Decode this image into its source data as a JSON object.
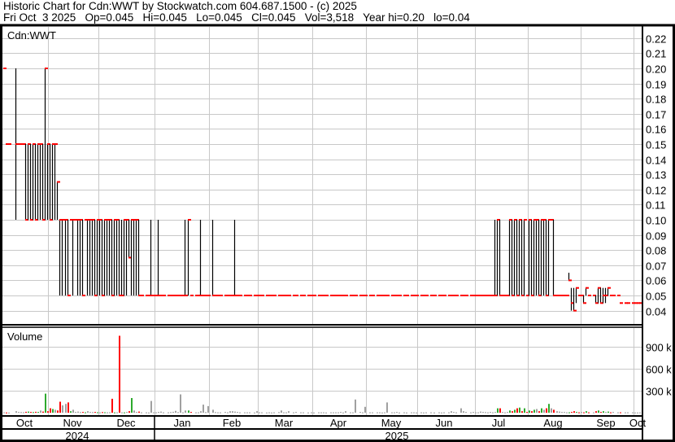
{
  "header": {
    "title": "Historic Chart for Cdn:WWT by Stockwatch.com 604.687.1500 - (c) 2025",
    "quote": "Fri Oct  3 2025   Op=0.045   Hi=0.045   Lo=0.045   Cl=0.045   Vol=3,518   Year hi=0.20   lo=0.04"
  },
  "chart_data": {
    "type": "bar",
    "subtype": "ohlc-with-volume",
    "symbol_label": "Cdn:WWT",
    "volume_label": "Volume",
    "price_axis": {
      "ticks": [
        0.04,
        0.05,
        0.06,
        0.07,
        0.08,
        0.09,
        0.1,
        0.11,
        0.12,
        0.13,
        0.14,
        0.15,
        0.16,
        0.17,
        0.18,
        0.19,
        0.2,
        0.21,
        0.22
      ],
      "range": [
        0.03,
        0.229
      ]
    },
    "volume_axis": {
      "ticks": [
        300,
        600,
        900
      ],
      "tick_labels": [
        "300 k",
        "600 k",
        "900 k"
      ],
      "unit": "k",
      "range": [
        0,
        1200
      ]
    },
    "months": [
      "Oct",
      "Nov",
      "Dec",
      "Jan",
      "Feb",
      "Mar",
      "Apr",
      "May",
      "Jun",
      "Jul",
      "Aug",
      "Sep",
      "Oct"
    ],
    "years": [
      "2024",
      "2025"
    ],
    "colors": {
      "close_tick": "#ff0000",
      "bar": "#000000",
      "vol_up": "#2eaa2e",
      "vol_down": "#ff0000",
      "vol_flat": "#a0a0a0",
      "grid": "#c8c8c8"
    },
    "bars_format": [
      "high",
      "low",
      "close",
      "volume_k"
    ],
    "bars": [
      [
        0.2,
        0.2,
        0.2,
        5
      ],
      [
        0.15,
        0.15,
        0.15,
        3
      ],
      [
        0.15,
        0.15,
        0.15,
        2
      ],
      null,
      null,
      [
        0.2,
        0.1,
        0.15,
        20
      ],
      [
        0.15,
        0.15,
        0.15,
        10
      ],
      [
        0.15,
        0.15,
        0.15,
        8
      ],
      [
        0.15,
        0.15,
        0.15,
        6
      ],
      [
        0.15,
        0.1,
        0.1,
        12
      ],
      [
        0.15,
        0.1,
        0.15,
        15
      ],
      [
        0.15,
        0.1,
        0.1,
        10
      ],
      [
        0.15,
        0.1,
        0.15,
        8
      ],
      [
        0.15,
        0.1,
        0.1,
        12
      ],
      [
        0.15,
        0.1,
        0.15,
        10
      ],
      [
        0.15,
        0.1,
        0.15,
        30
      ],
      [
        0.15,
        0.1,
        0.1,
        15
      ],
      [
        0.2,
        0.1,
        0.2,
        260
      ],
      [
        0.15,
        0.1,
        0.15,
        20
      ],
      [
        0.15,
        0.1,
        0.1,
        60
      ],
      [
        0.15,
        0.1,
        0.15,
        50
      ],
      [
        0.15,
        0.1,
        0.15,
        40
      ],
      [
        0.125,
        0.1,
        0.125,
        30
      ],
      [
        0.1,
        0.05,
        0.1,
        150
      ],
      [
        0.1,
        0.05,
        0.1,
        100
      ],
      [
        0.1,
        0.05,
        0.1,
        120
      ],
      [
        0.1,
        0.05,
        0.05,
        140
      ],
      [
        0.1,
        0.1,
        0.1,
        20
      ],
      [
        0.1,
        0.05,
        0.1,
        40
      ],
      [
        0.1,
        0.1,
        0.1,
        10
      ],
      [
        0.1,
        0.05,
        0.1,
        15
      ],
      [
        0.1,
        0.05,
        0.1,
        8
      ],
      [
        0.1,
        0.05,
        0.05,
        10
      ],
      [
        0.1,
        0.1,
        0.1,
        5
      ],
      [
        0.1,
        0.05,
        0.1,
        20
      ],
      [
        0.1,
        0.05,
        0.1,
        10
      ],
      [
        0.1,
        0.05,
        0.1,
        8
      ],
      [
        0.1,
        0.05,
        0.05,
        10
      ],
      [
        0.1,
        0.05,
        0.1,
        6
      ],
      [
        0.1,
        0.05,
        0.1,
        5
      ],
      [
        0.1,
        0.05,
        0.05,
        8
      ],
      [
        0.1,
        0.05,
        0.1,
        6
      ],
      [
        0.1,
        0.05,
        0.1,
        5
      ],
      [
        0.1,
        0.05,
        0.1,
        6
      ],
      [
        0.1,
        0.05,
        0.05,
        190
      ],
      [
        0.1,
        0.05,
        0.1,
        4
      ],
      [
        0.1,
        0.05,
        0.1,
        5
      ],
      [
        0.1,
        0.05,
        0.05,
        1050
      ],
      [
        0.1,
        0.05,
        0.05,
        5
      ],
      [
        0.1,
        0.05,
        0.1,
        4
      ],
      [
        0.1,
        0.05,
        0.1,
        10
      ],
      [
        0.1,
        0.075,
        0.075,
        20
      ],
      [
        0.1,
        0.05,
        0.1,
        200
      ],
      [
        0.1,
        0.05,
        0.1,
        30
      ],
      [
        0.1,
        0.05,
        0.1,
        10
      ],
      [
        0.1,
        0.05,
        0.05,
        15
      ],
      [
        0.05,
        0.05,
        0.05,
        5
      ],
      null,
      [
        0.05,
        0.05,
        0.05,
        5
      ],
      [
        0.05,
        0.05,
        0.05,
        3
      ],
      [
        0.1,
        0.05,
        0.05,
        160
      ],
      [
        0.05,
        0.05,
        0.05,
        5
      ],
      [
        0.05,
        0.05,
        0.05,
        5
      ],
      [
        0.1,
        0.05,
        0.05,
        10
      ],
      [
        0.05,
        0.05,
        0.05,
        15
      ],
      [
        0.05,
        0.05,
        0.05,
        5
      ],
      null,
      [
        0.05,
        0.05,
        0.05,
        5
      ],
      [
        0.05,
        0.05,
        0.05,
        8
      ],
      [
        0.05,
        0.05,
        0.05,
        12
      ],
      [
        0.05,
        0.05,
        0.05,
        25
      ],
      [
        0.05,
        0.05,
        0.05,
        8
      ],
      [
        0.05,
        0.05,
        0.05,
        250
      ],
      [
        0.05,
        0.05,
        0.05,
        5
      ],
      [
        0.1,
        0.05,
        0.05,
        30
      ],
      [
        0.1,
        0.05,
        0.1,
        30
      ],
      [
        0.05,
        0.05,
        0.05,
        10
      ],
      null,
      [
        0.05,
        0.05,
        0.05,
        5
      ],
      [
        0.05,
        0.05,
        0.05,
        5
      ],
      [
        0.1,
        0.05,
        0.05,
        20
      ],
      [
        0.05,
        0.05,
        0.05,
        110
      ],
      [
        0.05,
        0.05,
        0.05,
        8
      ],
      [
        0.05,
        0.05,
        0.05,
        90
      ],
      null,
      [
        0.1,
        0.05,
        0.05,
        40
      ],
      [
        0.05,
        0.05,
        0.05,
        8
      ],
      [
        0.05,
        0.05,
        0.05,
        5
      ],
      [
        0.05,
        0.05,
        0.05,
        5
      ],
      null,
      [
        0.05,
        0.05,
        0.05,
        10
      ],
      [
        0.05,
        0.05,
        0.05,
        5
      ],
      [
        0.05,
        0.05,
        0.05,
        20
      ],
      [
        0.05,
        0.05,
        0.05,
        20
      ],
      [
        0.1,
        0.05,
        0.05,
        15
      ],
      [
        0.05,
        0.05,
        0.05,
        10
      ],
      [
        0.05,
        0.05,
        0.05,
        5
      ],
      null,
      [
        0.05,
        0.05,
        0.05,
        5
      ],
      [
        0.05,
        0.05,
        0.05,
        5
      ],
      [
        0.05,
        0.05,
        0.05,
        5
      ],
      null,
      [
        0.05,
        0.05,
        0.05,
        3
      ],
      [
        0.05,
        0.05,
        0.05,
        20
      ],
      [
        0.05,
        0.05,
        0.05,
        5
      ],
      [
        0.05,
        0.05,
        0.05,
        5
      ],
      null,
      [
        0.05,
        0.05,
        0.05,
        3
      ],
      [
        0.05,
        0.05,
        0.05,
        5
      ],
      [
        0.05,
        0.05,
        0.05,
        3
      ],
      [
        0.05,
        0.05,
        0.05,
        5
      ],
      null,
      [
        0.05,
        0.05,
        0.05,
        8
      ],
      [
        0.05,
        0.05,
        0.05,
        30
      ],
      [
        0.05,
        0.05,
        0.05,
        5
      ],
      [
        0.05,
        0.05,
        0.05,
        5
      ],
      [
        0.05,
        0.05,
        0.05,
        20
      ],
      null,
      [
        0.05,
        0.05,
        0.05,
        5
      ],
      [
        0.05,
        0.05,
        0.05,
        10
      ],
      null,
      [
        0.05,
        0.05,
        0.05,
        5
      ],
      [
        0.05,
        0.05,
        0.05,
        5
      ],
      null,
      [
        0.05,
        0.05,
        0.05,
        3
      ],
      [
        0.05,
        0.05,
        0.05,
        5
      ],
      [
        0.05,
        0.05,
        0.05,
        3
      ],
      null,
      [
        0.05,
        0.05,
        0.05,
        5
      ],
      [
        0.05,
        0.05,
        0.05,
        5
      ],
      [
        0.05,
        0.05,
        0.05,
        5
      ],
      [
        0.05,
        0.05,
        0.05,
        3
      ],
      null,
      [
        0.05,
        0.05,
        0.05,
        5
      ],
      [
        0.05,
        0.05,
        0.05,
        5
      ],
      [
        0.05,
        0.05,
        0.05,
        5
      ],
      [
        0.05,
        0.05,
        0.05,
        5
      ],
      [
        0.05,
        0.05,
        0.05,
        10
      ],
      [
        0.05,
        0.05,
        0.05,
        3
      ],
      [
        0.05,
        0.05,
        0.05,
        20
      ],
      null,
      [
        0.05,
        0.05,
        0.05,
        5
      ],
      [
        0.05,
        0.05,
        0.05,
        5
      ],
      [
        0.05,
        0.05,
        0.05,
        180
      ],
      null,
      [
        0.05,
        0.05,
        0.05,
        10
      ],
      [
        0.05,
        0.05,
        0.05,
        5
      ],
      [
        0.05,
        0.05,
        0.05,
        80
      ],
      null,
      [
        0.05,
        0.05,
        0.05,
        5
      ],
      [
        0.05,
        0.05,
        0.05,
        5
      ],
      null,
      [
        0.05,
        0.05,
        0.05,
        5
      ],
      [
        0.05,
        0.05,
        0.05,
        5
      ],
      [
        0.05,
        0.05,
        0.05,
        3
      ],
      [
        0.05,
        0.05,
        0.05,
        5
      ],
      [
        0.05,
        0.05,
        0.05,
        140
      ],
      null,
      [
        0.05,
        0.05,
        0.05,
        5
      ],
      [
        0.05,
        0.05,
        0.05,
        5
      ],
      [
        0.05,
        0.05,
        0.05,
        10
      ],
      [
        0.05,
        0.05,
        0.05,
        3
      ],
      null,
      [
        0.05,
        0.05,
        0.05,
        5
      ],
      [
        0.05,
        0.05,
        0.05,
        3
      ],
      null,
      [
        0.05,
        0.05,
        0.05,
        5
      ],
      [
        0.05,
        0.05,
        0.05,
        5
      ],
      [
        0.05,
        0.05,
        0.05,
        3
      ],
      null,
      [
        0.05,
        0.05,
        0.05,
        5
      ],
      [
        0.05,
        0.05,
        0.05,
        3
      ],
      [
        0.05,
        0.05,
        0.05,
        5
      ],
      null,
      [
        0.05,
        0.05,
        0.05,
        5
      ],
      [
        0.05,
        0.05,
        0.05,
        3
      ],
      null,
      [
        0.05,
        0.05,
        0.05,
        5
      ],
      [
        0.05,
        0.05,
        0.05,
        3
      ],
      [
        0.05,
        0.05,
        0.05,
        5
      ],
      null,
      [
        0.05,
        0.05,
        0.05,
        5
      ],
      [
        0.05,
        0.05,
        0.05,
        20
      ],
      [
        0.05,
        0.05,
        0.05,
        10
      ],
      [
        0.05,
        0.05,
        0.05,
        5
      ],
      null,
      [
        0.05,
        0.05,
        0.05,
        60
      ],
      [
        0.05,
        0.05,
        0.05,
        20
      ],
      [
        0.05,
        0.05,
        0.05,
        10
      ],
      null,
      [
        0.05,
        0.05,
        0.05,
        5
      ],
      [
        0.05,
        0.05,
        0.05,
        10
      ],
      [
        0.05,
        0.05,
        0.05,
        5
      ],
      [
        0.05,
        0.05,
        0.05,
        5
      ],
      [
        0.05,
        0.05,
        0.05,
        15
      ],
      [
        0.05,
        0.05,
        0.05,
        10
      ],
      [
        0.05,
        0.05,
        0.05,
        8
      ],
      [
        0.05,
        0.05,
        0.05,
        5
      ],
      [
        0.05,
        0.05,
        0.05,
        10
      ],
      [
        0.05,
        0.05,
        0.05,
        5
      ],
      [
        0.1,
        0.05,
        0.05,
        10
      ],
      [
        0.1,
        0.05,
        0.1,
        60
      ],
      [
        0.1,
        0.05,
        0.05,
        60
      ],
      [
        0.05,
        0.05,
        0.05,
        10
      ],
      [
        0.05,
        0.05,
        0.05,
        5
      ],
      [
        0.05,
        0.05,
        0.05,
        10
      ],
      [
        0.1,
        0.05,
        0.1,
        30
      ],
      [
        0.1,
        0.05,
        0.05,
        20
      ],
      [
        0.1,
        0.05,
        0.1,
        40
      ],
      [
        0.1,
        0.05,
        0.05,
        60
      ],
      [
        0.1,
        0.05,
        0.1,
        70
      ],
      [
        0.1,
        0.05,
        0.05,
        20
      ],
      [
        0.1,
        0.05,
        0.1,
        60
      ],
      [
        0.05,
        0.05,
        0.05,
        10
      ],
      [
        0.1,
        0.05,
        0.1,
        30
      ],
      [
        0.1,
        0.05,
        0.05,
        20
      ],
      [
        0.1,
        0.05,
        0.1,
        40
      ],
      [
        0.1,
        0.05,
        0.1,
        50
      ],
      [
        0.1,
        0.05,
        0.05,
        20
      ],
      [
        0.1,
        0.05,
        0.1,
        60
      ],
      [
        0.1,
        0.05,
        0.1,
        40
      ],
      [
        0.1,
        0.05,
        0.05,
        60
      ],
      [
        0.1,
        0.05,
        0.1,
        120
      ],
      [
        0.1,
        0.1,
        0.1,
        60
      ],
      [
        0.1,
        0.05,
        0.05,
        40
      ],
      [
        0.05,
        0.05,
        0.05,
        20
      ],
      [
        0.05,
        0.05,
        0.05,
        15
      ],
      [
        0.05,
        0.05,
        0.05,
        10
      ],
      [
        0.05,
        0.05,
        0.05,
        10
      ],
      [
        0.05,
        0.05,
        0.05,
        5
      ],
      [
        0.065,
        0.06,
        0.06,
        5
      ],
      [
        0.055,
        0.04,
        0.045,
        10
      ],
      [
        0.055,
        0.04,
        0.04,
        20
      ],
      [
        0.055,
        0.045,
        0.055,
        10
      ],
      [
        0.05,
        0.05,
        0.05,
        5
      ],
      [
        0.05,
        0.05,
        0.05,
        10
      ],
      [
        0.05,
        0.045,
        0.045,
        5
      ],
      [
        0.055,
        0.05,
        0.055,
        20
      ],
      [
        0.05,
        0.05,
        0.05,
        5
      ],
      null,
      [
        0.05,
        0.05,
        0.05,
        5
      ],
      [
        0.05,
        0.045,
        0.045,
        20
      ],
      [
        0.055,
        0.045,
        0.055,
        30
      ],
      [
        0.055,
        0.045,
        0.045,
        10
      ],
      [
        0.055,
        0.045,
        0.05,
        20
      ],
      [
        0.055,
        0.045,
        0.05,
        10
      ],
      [
        0.055,
        0.05,
        0.055,
        15
      ],
      [
        0.05,
        0.05,
        0.05,
        5
      ],
      [
        0.05,
        0.05,
        0.05,
        10
      ],
      null,
      [
        0.05,
        0.05,
        0.05,
        5
      ],
      [
        0.045,
        0.045,
        0.045,
        5
      ],
      null,
      [
        0.045,
        0.045,
        0.045,
        5
      ],
      [
        0.045,
        0.045,
        0.045,
        5
      ],
      null,
      [
        0.045,
        0.045,
        0.045,
        5
      ],
      [
        0.045,
        0.045,
        0.045,
        3
      ],
      [
        0.045,
        0.045,
        0.045,
        3
      ],
      [
        0.045,
        0.045,
        0.045,
        4
      ]
    ]
  }
}
